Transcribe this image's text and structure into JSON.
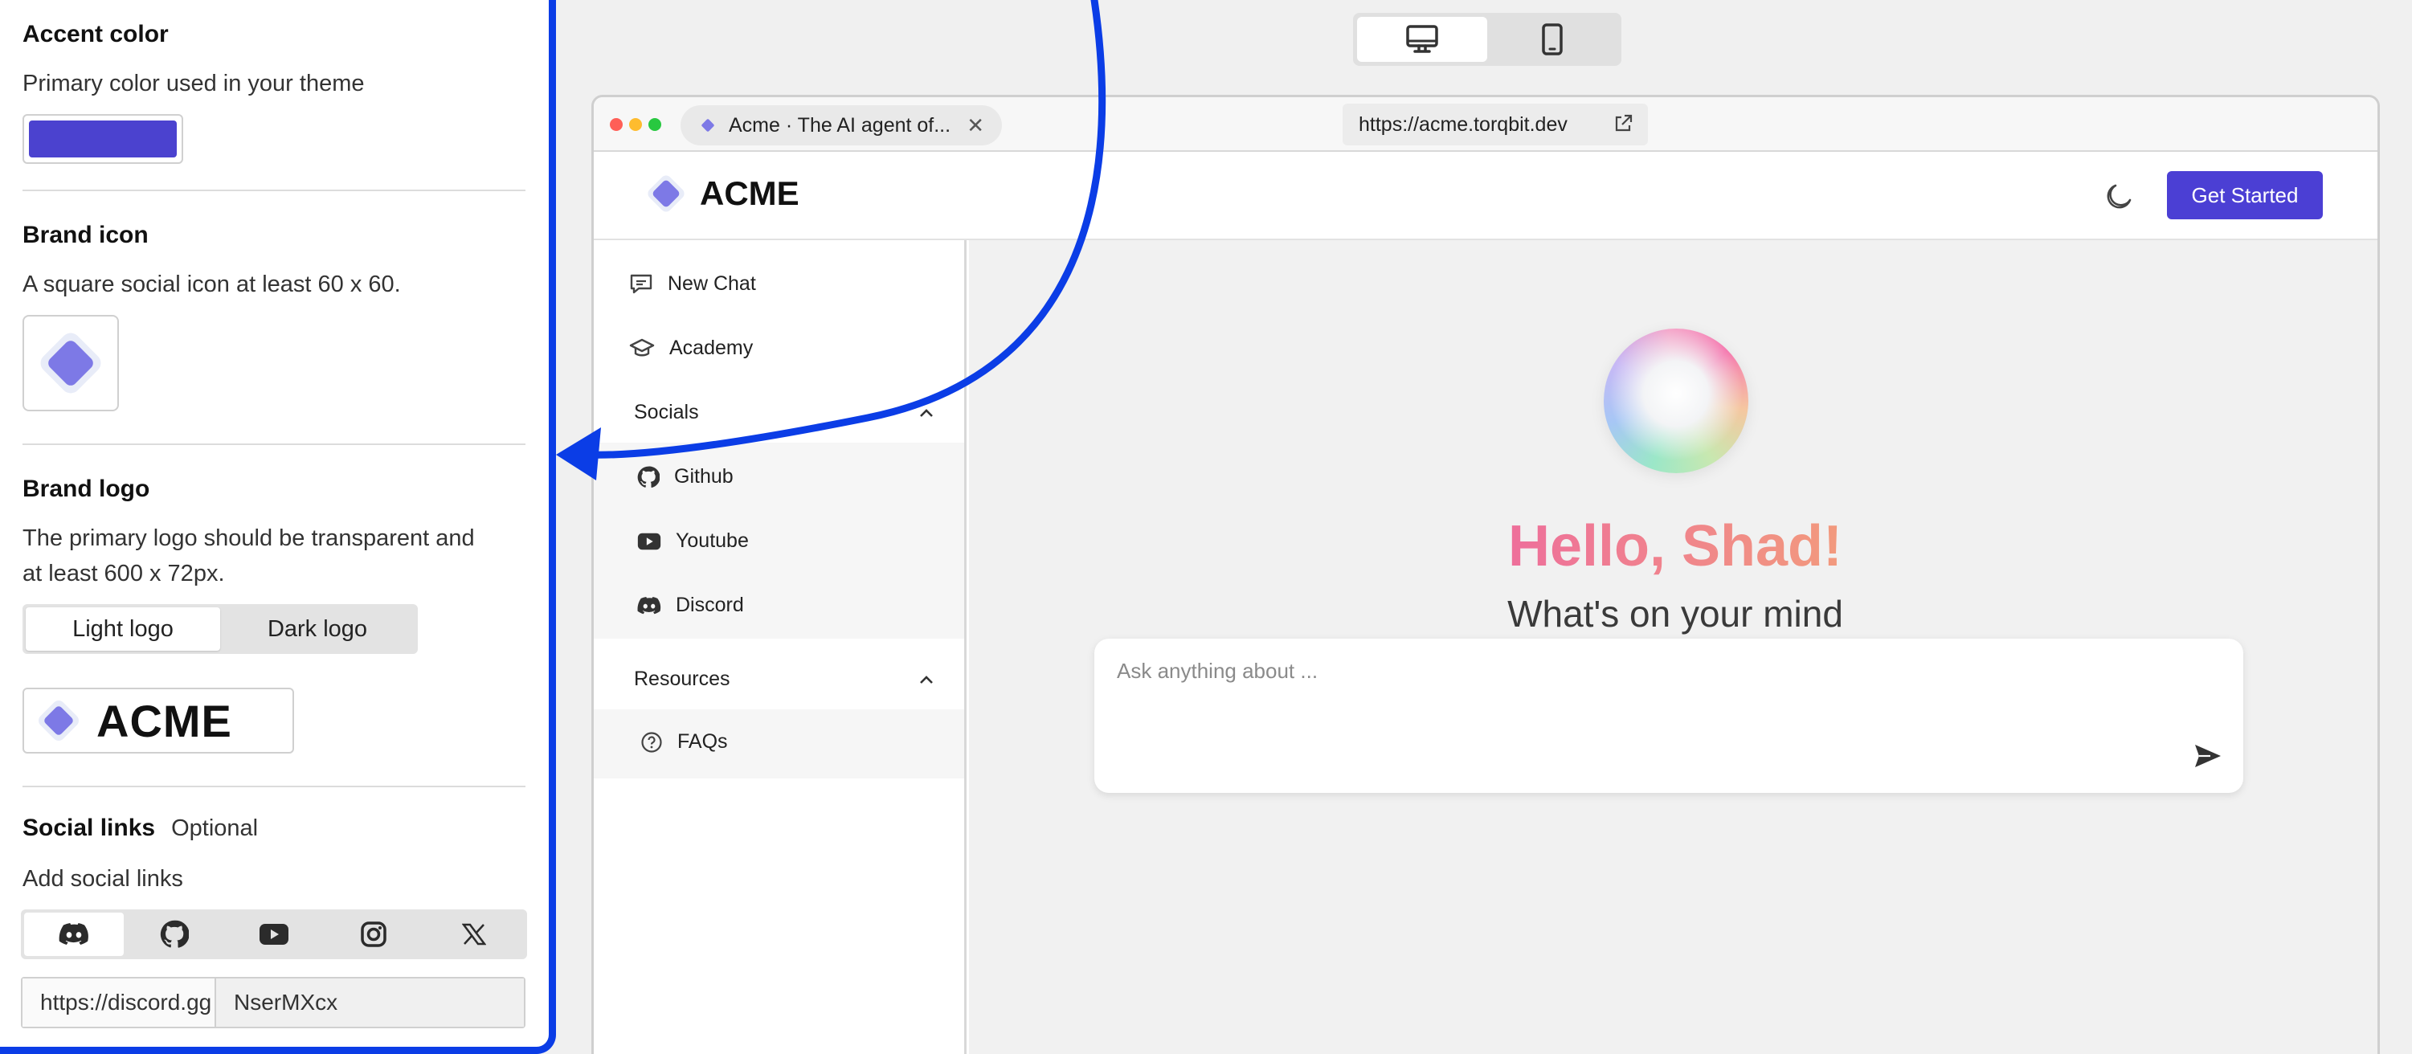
{
  "panel": {
    "accent": {
      "title": "Accent color",
      "desc": "Primary color used in your theme",
      "color": "#4b42cf"
    },
    "brand_icon": {
      "title": "Brand icon",
      "desc": "A square social icon at least 60 x 60."
    },
    "brand_logo": {
      "title": "Brand logo",
      "desc_line1": "The primary logo should be transparent and",
      "desc_line2": "at least 600 x 72px.",
      "tabs": [
        "Light logo",
        "Dark logo"
      ],
      "active_tab": "Light logo",
      "logo_text": "ACME"
    },
    "social": {
      "title": "Social links",
      "optional": "Optional",
      "desc": "Add social links",
      "icons": [
        "discord-icon",
        "github-icon",
        "youtube-icon",
        "instagram-icon",
        "x-icon"
      ],
      "active": "discord-icon",
      "prefix": "https://discord.gg",
      "value": "NserMXcx"
    }
  },
  "device_toggle": {
    "options": [
      "desktop-icon",
      "mobile-icon"
    ],
    "active": "desktop-icon"
  },
  "browser": {
    "tab_title": "Acme · The AI agent of...",
    "url": "https://acme.torqbit.dev",
    "dots": [
      "#ff5f57",
      "#febc2e",
      "#28c840"
    ]
  },
  "site": {
    "brand": "ACME",
    "cta": "Get Started",
    "cta_color": "#4b3fd4",
    "nav": {
      "new_chat": "New Chat",
      "academy": "Academy",
      "socials": "Socials",
      "socials_items": [
        "Github",
        "Youtube",
        "Discord"
      ],
      "resources": "Resources",
      "resources_items": [
        "FAQs"
      ]
    },
    "greeting": "Hello, Shad!",
    "subgreeting": "What's on your mind",
    "chat_placeholder": "Ask anything about ..."
  }
}
